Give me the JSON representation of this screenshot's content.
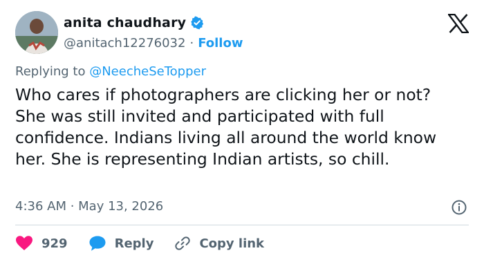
{
  "author": {
    "name": "anita chaudhary",
    "handle": "@anitach12276032",
    "separator": "·",
    "follow_label": "Follow"
  },
  "reply_context": {
    "prefix": "Replying to",
    "mention": "@NeecheSeTopper"
  },
  "tweet": {
    "text": "Who cares if photographers are clicking her or not? She was still invited and participated with full confidence. Indians living all around the world know her. She is representing Indian artists, so chill.",
    "timestamp": "4:36 AM · May 13, 2026"
  },
  "actions": {
    "like_count": "929",
    "reply_label": "Reply",
    "copy_link_label": "Copy link"
  },
  "icons": {
    "verified": "verified-badge-icon",
    "logo": "x-logo-icon",
    "info": "info-icon",
    "heart": "heart-icon",
    "reply": "speech-bubble-icon",
    "link": "link-icon"
  },
  "colors": {
    "accent": "#1d9bf0",
    "like": "#f91880",
    "muted_text": "#536471",
    "text": "#0f1419",
    "divider": "#cfd9de"
  }
}
